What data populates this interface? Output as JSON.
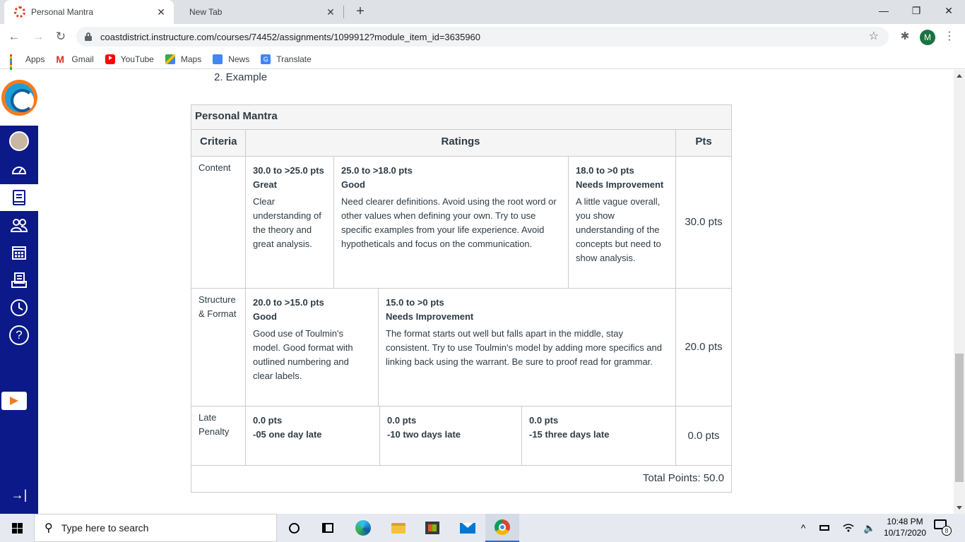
{
  "browser": {
    "tabs": [
      {
        "title": "Personal Mantra",
        "close": "✕"
      },
      {
        "title": "New Tab",
        "close": "✕"
      }
    ],
    "new_tab": "+",
    "window_controls": {
      "minimize": "—",
      "maximize": "❐",
      "close": "✕"
    },
    "nav": {
      "back": "←",
      "forward": "→",
      "reload": "↻"
    },
    "url": "coastdistrict.instructure.com/courses/74452/assignments/1099912?module_item_id=3635960",
    "star": "☆",
    "extensions": "✱",
    "profile_initial": "M",
    "menu": "⋮",
    "bookmarks": [
      {
        "label": "Apps",
        "icon": "apps-grid-icon"
      },
      {
        "label": "Gmail",
        "icon": "gmail-icon"
      },
      {
        "label": "YouTube",
        "icon": "youtube-icon"
      },
      {
        "label": "Maps",
        "icon": "maps-icon"
      },
      {
        "label": "News",
        "icon": "news-icon"
      },
      {
        "label": "Translate",
        "icon": "translate-icon"
      }
    ],
    "apps_colors": [
      "#ea4335",
      "#fbbc04",
      "#34a853",
      "#4285f4",
      "#ea4335",
      "#fbbc04",
      "#34a853",
      "#4285f4",
      "#ea4335"
    ]
  },
  "canvas_nav": {
    "background": "#0b1989",
    "accent": "#f47b20",
    "items": [
      "account",
      "dashboard",
      "courses",
      "groups",
      "calendar",
      "inbox",
      "history",
      "help"
    ],
    "selected": "courses",
    "help_glyph": "?",
    "collapse_glyph": "→|"
  },
  "page": {
    "example_line": "2. Example",
    "rubric": {
      "title": "Personal Mantra",
      "headers": {
        "criteria": "Criteria",
        "ratings": "Ratings",
        "pts": "Pts"
      },
      "rows": [
        {
          "criterion": "Content",
          "pts": "30.0 pts",
          "ratings": [
            {
              "range": "30.0 to >25.0 pts",
              "title": "Great",
              "description": "Clear understanding of the theory and great analysis."
            },
            {
              "range": "25.0 to >18.0 pts",
              "title": "Good",
              "description": "Need clearer definitions. Avoid using the root word or other values when defining your own. Try to use specific examples from your life experience. Avoid hypotheticals and focus on the communication."
            },
            {
              "range": "18.0 to >0 pts",
              "title": "Needs Improvement",
              "description": "A little vague overall, you show understanding of the concepts but need to show analysis."
            }
          ]
        },
        {
          "criterion": "Structure & Format",
          "pts": "20.0 pts",
          "ratings": [
            {
              "range": "20.0 to >15.0 pts",
              "title": "Good",
              "description": "Good use of Toulmin's model. Good format with outlined numbering and clear labels."
            },
            {
              "range": "15.0 to >0 pts",
              "title": "Needs Improvement",
              "description": "The format starts out well but falls apart in the middle, stay consistent. Try to use Toulmin's model by adding more specifics and linking back using the warrant. Be sure to proof read for grammar."
            }
          ]
        },
        {
          "criterion": "Late Penalty",
          "pts": "0.0 pts",
          "ratings": [
            {
              "range": "0.0 pts",
              "title": "-05 one day late",
              "description": ""
            },
            {
              "range": "0.0 pts",
              "title": "-10 two days late",
              "description": ""
            },
            {
              "range": "0.0 pts",
              "title": "-15 three days late",
              "description": ""
            }
          ]
        }
      ],
      "total": "Total Points: 50.0"
    }
  },
  "taskbar": {
    "search_placeholder": "Type here to search",
    "apps": [
      "cortana",
      "task-view",
      "edge",
      "file-explorer",
      "store",
      "mail",
      "chrome"
    ],
    "active_app": "chrome",
    "tray": {
      "chevron": "^",
      "volume": "🔈"
    },
    "time": "10:48 PM",
    "date": "10/17/2020",
    "notification_count": "8"
  }
}
